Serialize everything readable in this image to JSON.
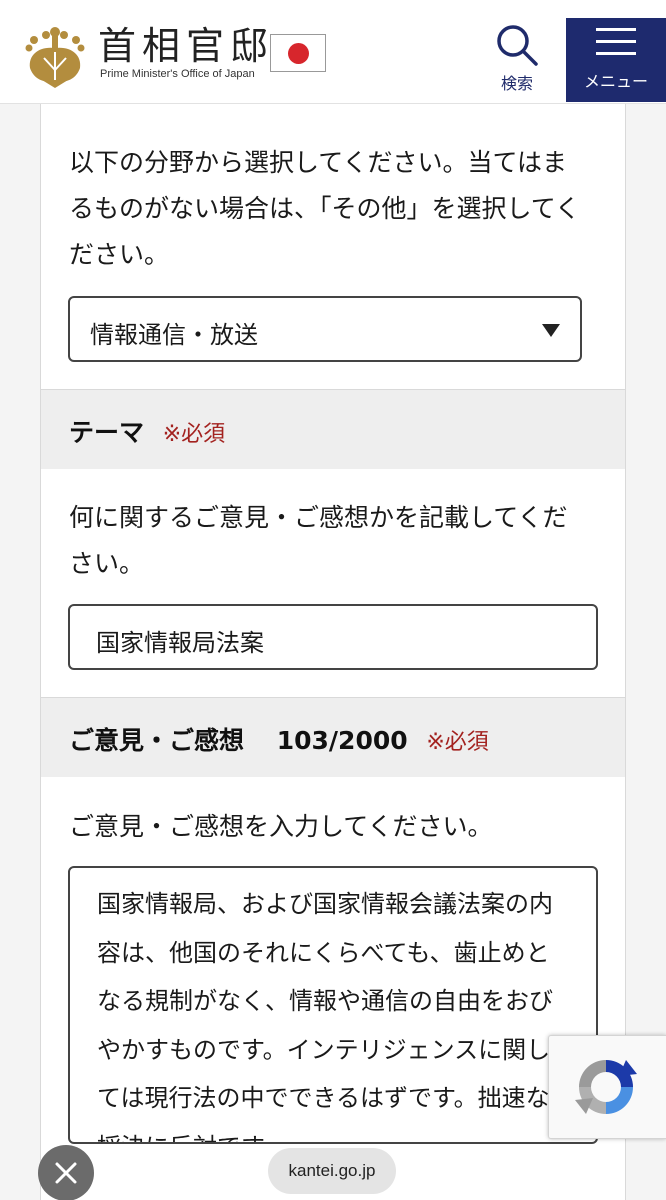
{
  "header": {
    "site_title": "首相官邸",
    "site_subtitle": "Prime Minister's Office of Japan",
    "search_label": "検索",
    "menu_label": "メニュー",
    "icons": {
      "logo": "paulownia-crest-icon",
      "flag": "japan-flag-icon",
      "search": "search-icon",
      "menu": "hamburger-menu-icon"
    },
    "colors": {
      "menu_bg": "#1e2a6e",
      "flag_sun": "#d7262c",
      "logo_gold": "#b38d3e"
    }
  },
  "field_category": {
    "instruction": "以下の分野から選択してください。当てはまるものがない場合は、「その他」を選択してください。",
    "selected_value": "情報通信・放送"
  },
  "field_theme": {
    "heading": "テーマ",
    "required": "※必須",
    "instruction": "何に関するご意見・ご感想かを記載してください。",
    "value": "国家情報局法案"
  },
  "field_opinion": {
    "heading": "ご意見・ご感想",
    "counter": "103/2000",
    "required": "※必須",
    "instruction": "ご意見・ご感想を入力してください。",
    "value": "国家情報局、および国家情報会議法案の内容は、他国のそれにくらべても、歯止めとなる規制がなく、情報や通信の自由をおびやかすものです。インテリジェンスに関しては現行法の中でできるはずです。拙速な採決に反対です。"
  },
  "browser": {
    "url": "kantei.go.jp",
    "close_icon": "close-icon",
    "recaptcha_icon": "recaptcha-icon",
    "required_color": "#a3221f"
  }
}
